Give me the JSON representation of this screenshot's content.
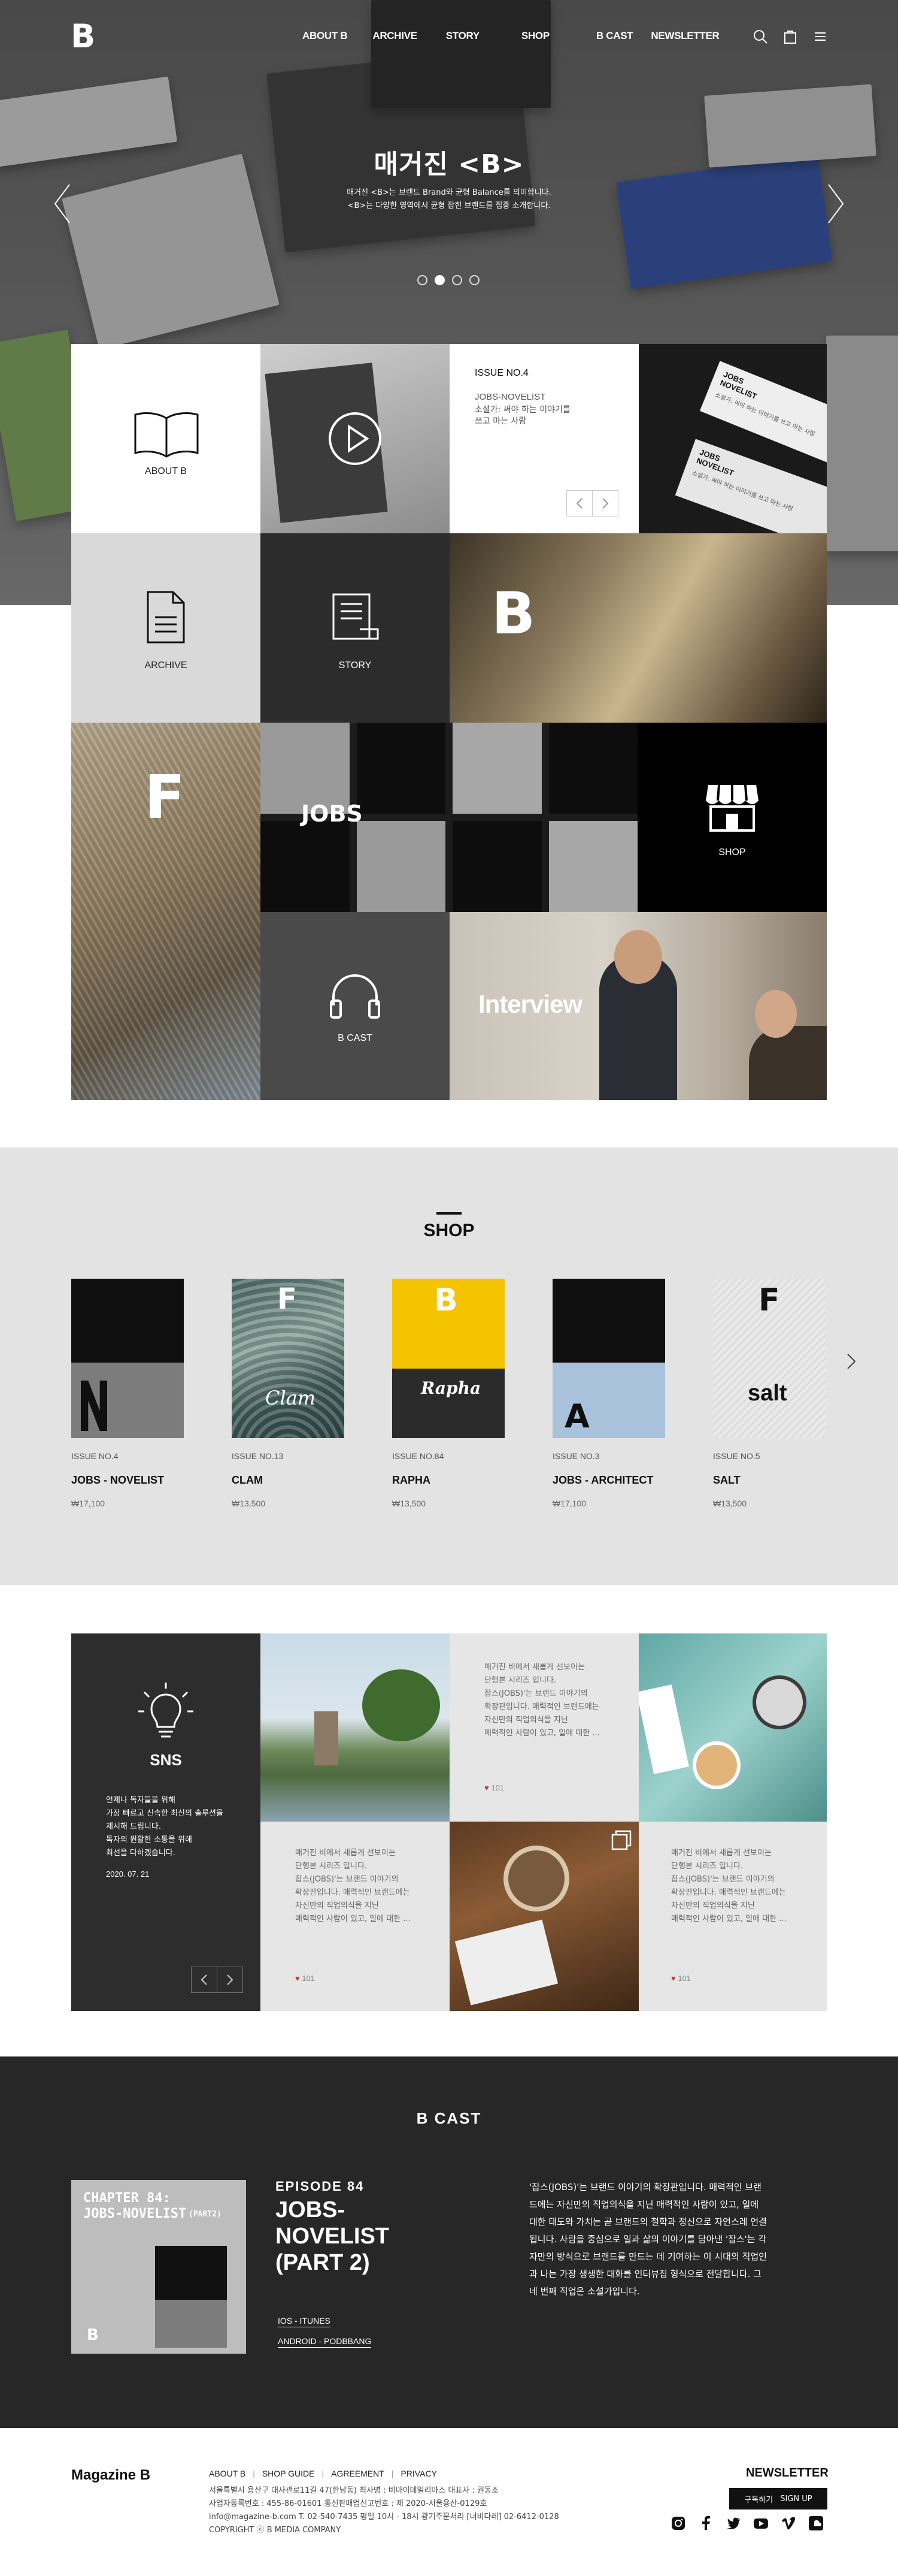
{
  "header": {
    "logo": "B",
    "nav": [
      "ABOUT B",
      "ARCHIVE",
      "STORY",
      "SHOP",
      "B CAST",
      "NEWSLETTER"
    ]
  },
  "hero": {
    "title": "매거진 <B>",
    "sub1": "매거진 <B>는 브랜드 Brand와 균형 Balance를 의미합니다.",
    "sub2": "<B>는 다양한 영역에서 균형 잡힌 브랜드를 집중 소개합니다.",
    "slides": 4,
    "active_slide": 1
  },
  "grid": {
    "about": "ABOUT B",
    "issue_no": "ISSUE NO.4",
    "issue_title": "JOBS-NOVELIST",
    "issue_desc_1": "소설가: 써야 하는 이야기를",
    "issue_desc_2": "쓰고 마는 사람",
    "book_cover_l1": "JOBS",
    "book_cover_l2": "NOVELIST",
    "book_cover_desc": "소설가: 써야 하는 이야기를 쓰고 마는 사람",
    "archive": "ARCHIVE",
    "story": "STORY",
    "b_letter": "B",
    "f_letter": "F",
    "jobs": "JOBS",
    "shop": "SHOP",
    "bcast": "B CAST",
    "interview": "Interview"
  },
  "shop": {
    "title": "SHOP",
    "products": [
      {
        "issue": "ISSUE NO.4",
        "name": "JOBS - NOVELIST",
        "price": "₩17,100",
        "cover": "jobs"
      },
      {
        "issue": "ISSUE NO.13",
        "name": "CLAM",
        "price": "₩13,500",
        "cover": "clam",
        "cover_text": "Clam"
      },
      {
        "issue": "ISSUE NO.84",
        "name": "RAPHA",
        "price": "₩13,500",
        "cover": "rapha",
        "cover_text": "Rapha"
      },
      {
        "issue": "ISSUE NO.3",
        "name": "JOBS - ARCHITECT",
        "price": "₩17,100",
        "cover": "architect"
      },
      {
        "issue": "ISSUE NO.5",
        "name": "SALT",
        "price": "₩13,500",
        "cover": "salt",
        "cover_text": "salt"
      }
    ]
  },
  "sns": {
    "title": "SNS",
    "desc": [
      "언제나 독자들을 위해",
      "가장 빠르고 신속한 최신의 솔루션을",
      "제시해 드립니다.",
      "독자의 원활한 소통을 위해",
      "최선을 다하겠습니다."
    ],
    "date": "2020. 07. 21",
    "post_text": [
      "매거진 비에서 새롭게 선보이는",
      "단행본 시리즈 입니다.",
      "잡스(JOBS)'는 브랜드 이야기의",
      "확장판입니다. 매력적인 브랜드에는",
      "자신만의 직업의식을 지닌",
      "매력적인 사람이 있고, 일에 대한 ..."
    ],
    "likes": "101"
  },
  "bcast": {
    "title": "B CAST",
    "cover_l1": "CHAPTER 84:",
    "cover_l2": "JOBS-NOVELIST",
    "cover_l3": "(PART2)",
    "episode": "EPISODE 84",
    "ep_title": [
      "JOBS-",
      "NOVELIST",
      "(PART 2)"
    ],
    "links": [
      "IOS - ITUNES",
      "ANDROID - PODBBANG"
    ],
    "desc": [
      "'잡스(JOBS)'는 브랜드 이야기의 확장판입니다. 매력적인 브랜",
      "드에는 자신만의 직업의식을 지닌 매력적인 사람이 있고, 일에",
      "대한 태도와 가치는 곧 브랜드의 철학과 정신으로 자연스레 연결",
      "됩니다. 사람을 중심으로 일과 삶의 이야기를 담아낸 '잡스'는 각",
      "자만의 방식으로 브랜드를 만드는 데 기여하는 이 시대의 직업인",
      "과 나는 가장 생생한 대화를 인터뷰집 형식으로 전달합니다. 그",
      "네 번째 직업은 소설가입니다."
    ]
  },
  "footer": {
    "brand": "Magazine B",
    "links": [
      "ABOUT B",
      "SHOP GUIDE",
      "AGREEMENT",
      "PRIVACY"
    ],
    "info": [
      "서울특별시 용산구 대사관로11길 47(한남동) 최사명 : 비마이데일리마스 대표자 : 권동조",
      "사업자등록번호 : 455-86-01601 통신판매업신고번호 : 제 2020-서울용산-0129호",
      "info@magazine-b.com T. 02-540-7435 평일 10시 - 18시 광기주문처리 [너비다레] 02-6412-0128",
      "COPYRIGHT ⓒ B MEDIA COMPANY"
    ],
    "newsletter": "NEWSLETTER",
    "subscribe": "구독하기",
    "signup": "SIGN UP",
    "social": [
      "instagram-icon",
      "facebook-icon",
      "twitter-icon",
      "youtube-icon",
      "vimeo-icon",
      "soundcloud-icon"
    ]
  },
  "colors": {
    "dark": "#262626",
    "grey_tile": "#d9d9d9",
    "shop_bg": "#e3e3e3",
    "accent_yellow": "#f5c400",
    "heart": "#c0392b"
  }
}
